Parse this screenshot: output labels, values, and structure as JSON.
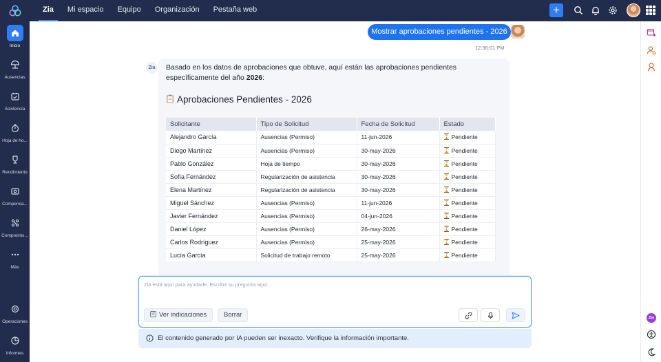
{
  "topbar": {
    "tabs": [
      {
        "label": "Zia",
        "active": true
      },
      {
        "label": "Mi espacio",
        "active": false
      },
      {
        "label": "Equipo",
        "active": false
      },
      {
        "label": "Organización",
        "active": false
      },
      {
        "label": "Pestaña web",
        "active": false
      }
    ],
    "add_label": "+"
  },
  "sidebar": {
    "items": [
      {
        "label": "Inicio",
        "icon": "home-icon",
        "active": true
      },
      {
        "label": "Ausencias",
        "icon": "umbrella-icon"
      },
      {
        "label": "Asistencia",
        "icon": "calendar-check-icon"
      },
      {
        "label": "Hoja de ho...",
        "icon": "timer-icon"
      },
      {
        "label": "Rendimiento",
        "icon": "trophy-icon"
      },
      {
        "label": "Compensa...",
        "icon": "compensation-icon"
      },
      {
        "label": "Compromis...",
        "icon": "engagement-icon"
      },
      {
        "label": "Más",
        "icon": "more-icon"
      },
      {
        "label": "Operaciones",
        "icon": "operations-icon"
      },
      {
        "label": "Informes",
        "icon": "reports-icon"
      }
    ]
  },
  "chat": {
    "user_message": "Mostrar aprobaciones pendientes - 2026",
    "timestamp": "12:36:01 PM",
    "bot_avatar_label": "Zia",
    "answer_text_prefix": "Basado en los datos de aprobaciones que obtuve, aquí están las aprobaciones pendientes específicamente del año ",
    "answer_text_year": "2026",
    "answer_text_suffix": ":",
    "answer_title": "Aprobaciones Pendientes - 2026",
    "table": {
      "headers": [
        "Solicitante",
        "Tipo de Solicitud",
        "Fecha de Solicitud",
        "Estado"
      ],
      "rows": [
        [
          "Alejandro García",
          "Ausencias (Permiso)",
          "11-jun-2026",
          "Pendiente"
        ],
        [
          "Diego Martínez",
          "Ausencias (Permiso)",
          "30-may-2026",
          "Pendiente"
        ],
        [
          "Pablo González",
          "Hoja de tiempo",
          "30-may-2026",
          "Pendiente"
        ],
        [
          "Sofía Fernández",
          "Regularización de asistencia",
          "30-may-2026",
          "Pendiente"
        ],
        [
          "Elena Martínez",
          "Regularización de asistencia",
          "30-may-2026",
          "Pendiente"
        ],
        [
          "Miguel Sánchez",
          "Ausencias (Permiso)",
          "11-jun-2026",
          "Pendiente"
        ],
        [
          "Javier Fernández",
          "Ausencias (Permiso)",
          "04-jun-2026",
          "Pendiente"
        ],
        [
          "Daniel López",
          "Ausencias (Permiso)",
          "26-may-2026",
          "Pendiente"
        ],
        [
          "Carlos Rodríguez",
          "Ausencias (Permiso)",
          "25-may-2026",
          "Pendiente"
        ],
        [
          "Lucía García",
          "Solicitud de trabajo remoto",
          "25-may-2026",
          "Pendiente"
        ]
      ]
    }
  },
  "composer": {
    "placeholder": "Zia está aquí para ayudarle. Escriba su pregunta aquí...",
    "prompts_label": "Ver indicaciones",
    "clear_label": "Borrar"
  },
  "notice": {
    "text": "El contenido generado por IA pueden ser inexacto. Verifique la información importante."
  },
  "colors": {
    "topbar": "#222c4c",
    "accent": "#1e73f0"
  }
}
